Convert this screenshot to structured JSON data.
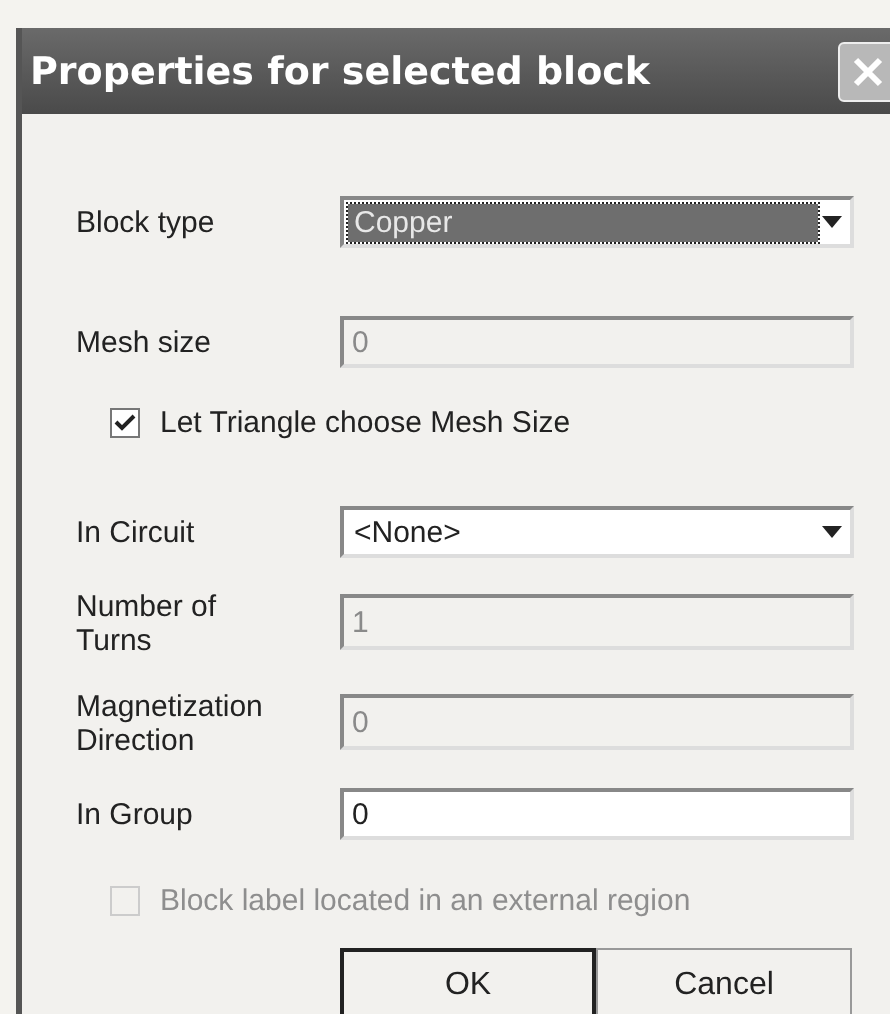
{
  "window": {
    "title": "Properties for selected block"
  },
  "rows": [
    {
      "kind": "dropdown",
      "label": "Block type",
      "value": "Copper",
      "highlighted": true
    },
    {
      "kind": "text",
      "label": "Mesh size",
      "value": "0",
      "disabled": true
    },
    {
      "kind": "checkbox",
      "label": "Let Triangle choose Mesh Size",
      "checked": true,
      "disabled": false
    },
    {
      "kind": "dropdown",
      "label": "In Circuit",
      "value": "<None>",
      "highlighted": false
    },
    {
      "kind": "text",
      "label": "Number of Turns",
      "value": "1",
      "disabled": true
    },
    {
      "kind": "text",
      "label": "Magnetization Direction",
      "value": "0",
      "disabled": true
    },
    {
      "kind": "text",
      "label": "In Group",
      "value": "0",
      "disabled": false
    },
    {
      "kind": "checkbox",
      "label": "Block label located in an external region",
      "checked": false,
      "disabled": true
    }
  ],
  "buttons": [
    {
      "label": "OK",
      "default": true
    },
    {
      "label": "Cancel",
      "default": false
    }
  ]
}
